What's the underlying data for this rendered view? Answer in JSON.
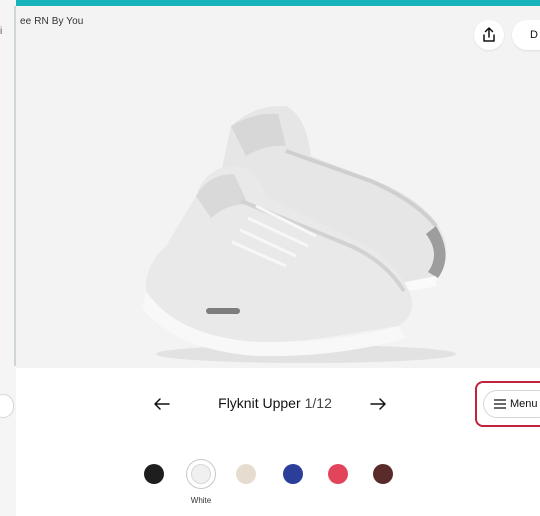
{
  "product": {
    "title": "ee RN By You"
  },
  "header": {
    "share_icon": "share-icon",
    "done_label": "D"
  },
  "left_fragments": {
    "top": "i",
    "bottom": "u"
  },
  "nav": {
    "part_name": "Flyknit Upper",
    "part_count": "1/12",
    "prev_icon": "arrow-left-icon",
    "next_icon": "arrow-right-icon"
  },
  "menu": {
    "label": "Menu",
    "icon": "hamburger-icon"
  },
  "colors": {
    "accent": "#15b4bb",
    "highlight": "#c0233b",
    "swatches": [
      "#1e1e1e",
      "#f0f0f0",
      "#e6ddd0",
      "#2a3e9a",
      "#e2445c",
      "#5b2a2a"
    ]
  },
  "selected_color": "White"
}
